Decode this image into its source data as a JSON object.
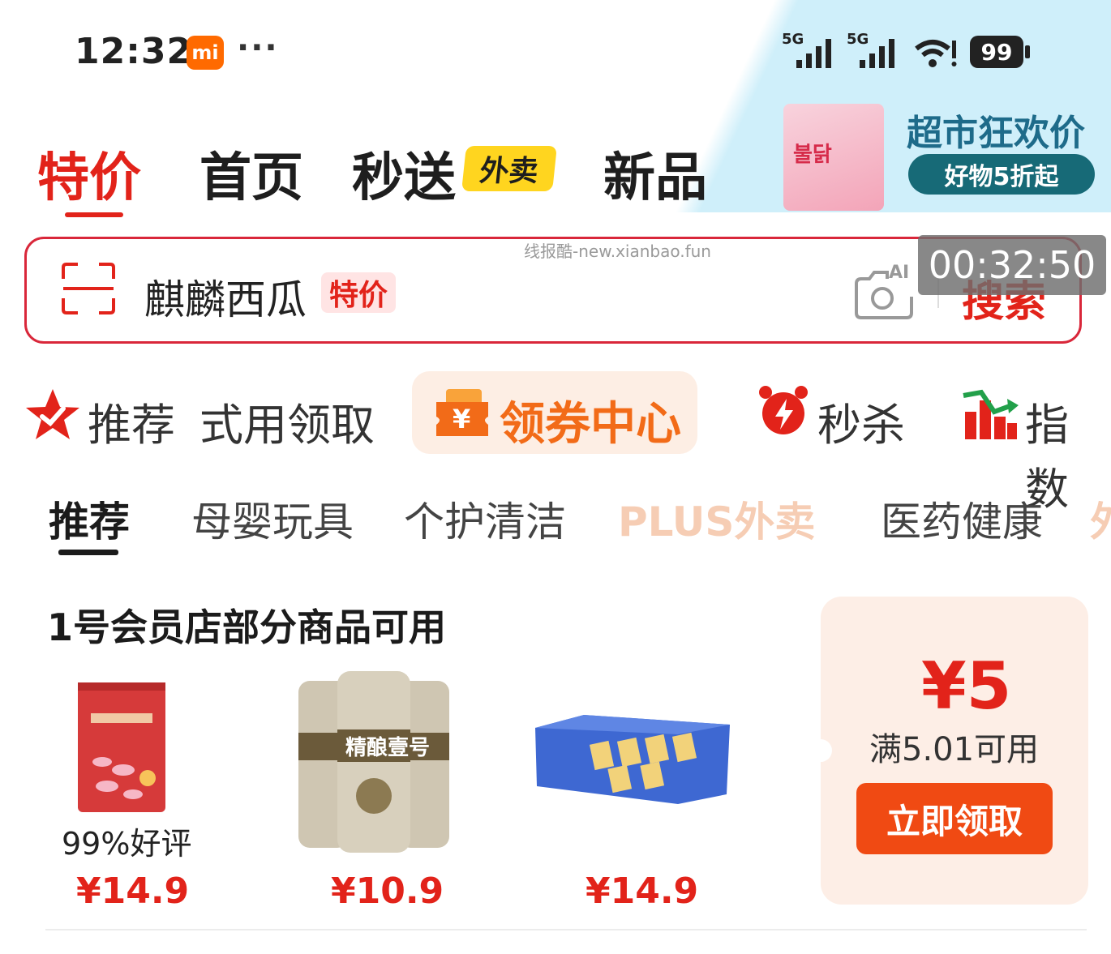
{
  "status_bar": {
    "time": "12:32",
    "app_badge": "mi",
    "dots": "···",
    "signal1": "5G",
    "signal2": "5G",
    "battery": "99"
  },
  "promo": {
    "title": "超市狂欢价",
    "pill": "好物5折起",
    "pack_label": "불닭"
  },
  "top_tabs": [
    {
      "label": "特价"
    },
    {
      "label": "首页"
    },
    {
      "label": "秒送"
    },
    {
      "label": "新品"
    }
  ],
  "waimai_tag": "外卖",
  "watermark": "线报酷-new.xianbao.fun",
  "search": {
    "text": "麒麟西瓜",
    "tag": "特价",
    "button": "搜索",
    "ai_label": "AI",
    "timer": "00:32:50"
  },
  "quick_nav": {
    "recommend": "推荐",
    "trial": "式用领取",
    "coupon_center": "领券中心",
    "coupon_symbol": "¥",
    "flash_sale": "秒杀",
    "index": "指数"
  },
  "categories": [
    {
      "label": "推荐"
    },
    {
      "label": "母婴玩具"
    },
    {
      "label": "个护清洁"
    },
    {
      "label": "PLUS外卖"
    },
    {
      "label": "医药健康"
    },
    {
      "label": "外"
    }
  ],
  "section": {
    "title": "1号会员店部分商品可用"
  },
  "products": [
    {
      "price": "¥14.9",
      "rating": "99%好评"
    },
    {
      "price": "¥10.9",
      "can_text": "精酿壹号"
    },
    {
      "price": "¥14.9"
    }
  ],
  "coupon_card": {
    "amount": "¥5",
    "condition": "满5.01可用",
    "button": "立即领取"
  },
  "colors": {
    "accent_red": "#e2231a",
    "coupon_orange": "#f04a13",
    "promo_teal": "#176a77"
  }
}
